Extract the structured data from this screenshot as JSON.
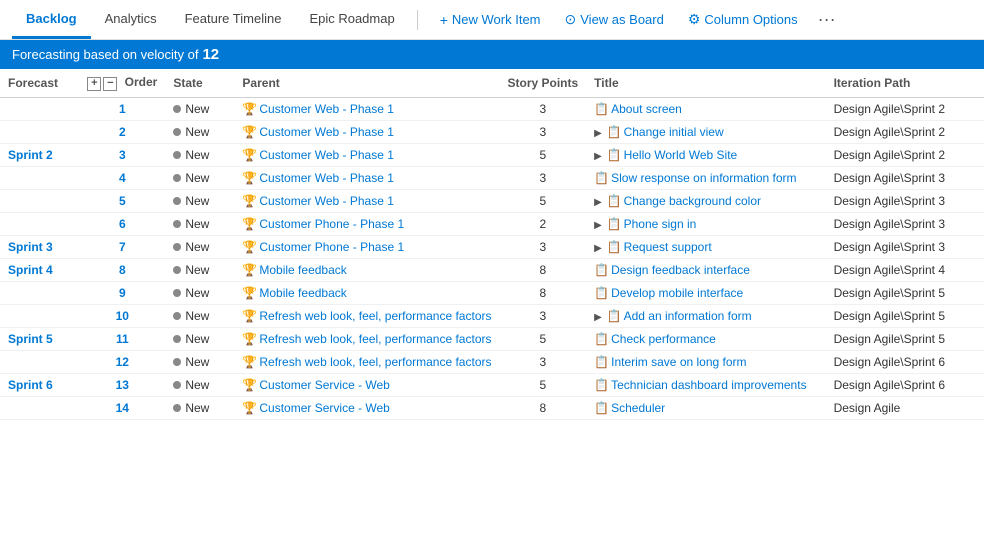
{
  "nav": {
    "tabs": [
      {
        "id": "backlog",
        "label": "Backlog",
        "active": true
      },
      {
        "id": "analytics",
        "label": "Analytics",
        "active": false
      },
      {
        "id": "feature-timeline",
        "label": "Feature Timeline",
        "active": false
      },
      {
        "id": "epic-roadmap",
        "label": "Epic Roadmap",
        "active": false
      }
    ],
    "actions": [
      {
        "id": "new-work-item",
        "label": "New Work Item",
        "icon": "+"
      },
      {
        "id": "view-as-board",
        "label": "View as Board",
        "icon": "⊙"
      },
      {
        "id": "column-options",
        "label": "Column Options",
        "icon": "🔧"
      }
    ],
    "more": "···"
  },
  "forecast": {
    "text_prefix": "Forecasting based on velocity of",
    "velocity": "12"
  },
  "table": {
    "headers": [
      "Forecast",
      "Order",
      "State",
      "Parent",
      "Story Points",
      "Title",
      "Iteration Path"
    ],
    "rows": [
      {
        "sprint": "",
        "order": "1",
        "state": "New",
        "parent": "Customer Web - Phase 1",
        "points": "3",
        "title": "About screen",
        "iteration": "Design Agile\\Sprint 2",
        "has_expand": false
      },
      {
        "sprint": "",
        "order": "2",
        "state": "New",
        "parent": "Customer Web - Phase 1",
        "points": "3",
        "title": "Change initial view",
        "iteration": "Design Agile\\Sprint 2",
        "has_expand": true
      },
      {
        "sprint": "Sprint 2",
        "order": "3",
        "state": "New",
        "parent": "Customer Web - Phase 1",
        "points": "5",
        "title": "Hello World Web Site",
        "iteration": "Design Agile\\Sprint 2",
        "has_expand": true
      },
      {
        "sprint": "",
        "order": "4",
        "state": "New",
        "parent": "Customer Web - Phase 1",
        "points": "3",
        "title": "Slow response on information form",
        "iteration": "Design Agile\\Sprint 3",
        "has_expand": false
      },
      {
        "sprint": "",
        "order": "5",
        "state": "New",
        "parent": "Customer Web - Phase 1",
        "points": "5",
        "title": "Change background color",
        "iteration": "Design Agile\\Sprint 3",
        "has_expand": true
      },
      {
        "sprint": "",
        "order": "6",
        "state": "New",
        "parent": "Customer Phone - Phase 1",
        "points": "2",
        "title": "Phone sign in",
        "iteration": "Design Agile\\Sprint 3",
        "has_expand": true
      },
      {
        "sprint": "Sprint 3",
        "order": "7",
        "state": "New",
        "parent": "Customer Phone - Phase 1",
        "points": "3",
        "title": "Request support",
        "iteration": "Design Agile\\Sprint 3",
        "has_expand": true
      },
      {
        "sprint": "Sprint 4",
        "order": "8",
        "state": "New",
        "parent": "Mobile feedback",
        "points": "8",
        "title": "Design feedback interface",
        "iteration": "Design Agile\\Sprint 4",
        "has_expand": false
      },
      {
        "sprint": "",
        "order": "9",
        "state": "New",
        "parent": "Mobile feedback",
        "points": "8",
        "title": "Develop mobile interface",
        "iteration": "Design Agile\\Sprint 5",
        "has_expand": false
      },
      {
        "sprint": "",
        "order": "10",
        "state": "New",
        "parent": "Refresh web look, feel, performance factors",
        "points": "3",
        "title": "Add an information form",
        "iteration": "Design Agile\\Sprint 5",
        "has_expand": true
      },
      {
        "sprint": "Sprint 5",
        "order": "11",
        "state": "New",
        "parent": "Refresh web look, feel, performance factors",
        "points": "5",
        "title": "Check performance",
        "iteration": "Design Agile\\Sprint 5",
        "has_expand": false
      },
      {
        "sprint": "",
        "order": "12",
        "state": "New",
        "parent": "Refresh web look, feel, performance factors",
        "points": "3",
        "title": "Interim save on long form",
        "iteration": "Design Agile\\Sprint 6",
        "has_expand": false
      },
      {
        "sprint": "Sprint 6",
        "order": "13",
        "state": "New",
        "parent": "Customer Service - Web",
        "points": "5",
        "title": "Technician dashboard improvements",
        "iteration": "Design Agile\\Sprint 6",
        "has_expand": false
      },
      {
        "sprint": "",
        "order": "14",
        "state": "New",
        "parent": "Customer Service - Web",
        "points": "8",
        "title": "Scheduler",
        "iteration": "Design Agile",
        "has_expand": false
      }
    ]
  }
}
